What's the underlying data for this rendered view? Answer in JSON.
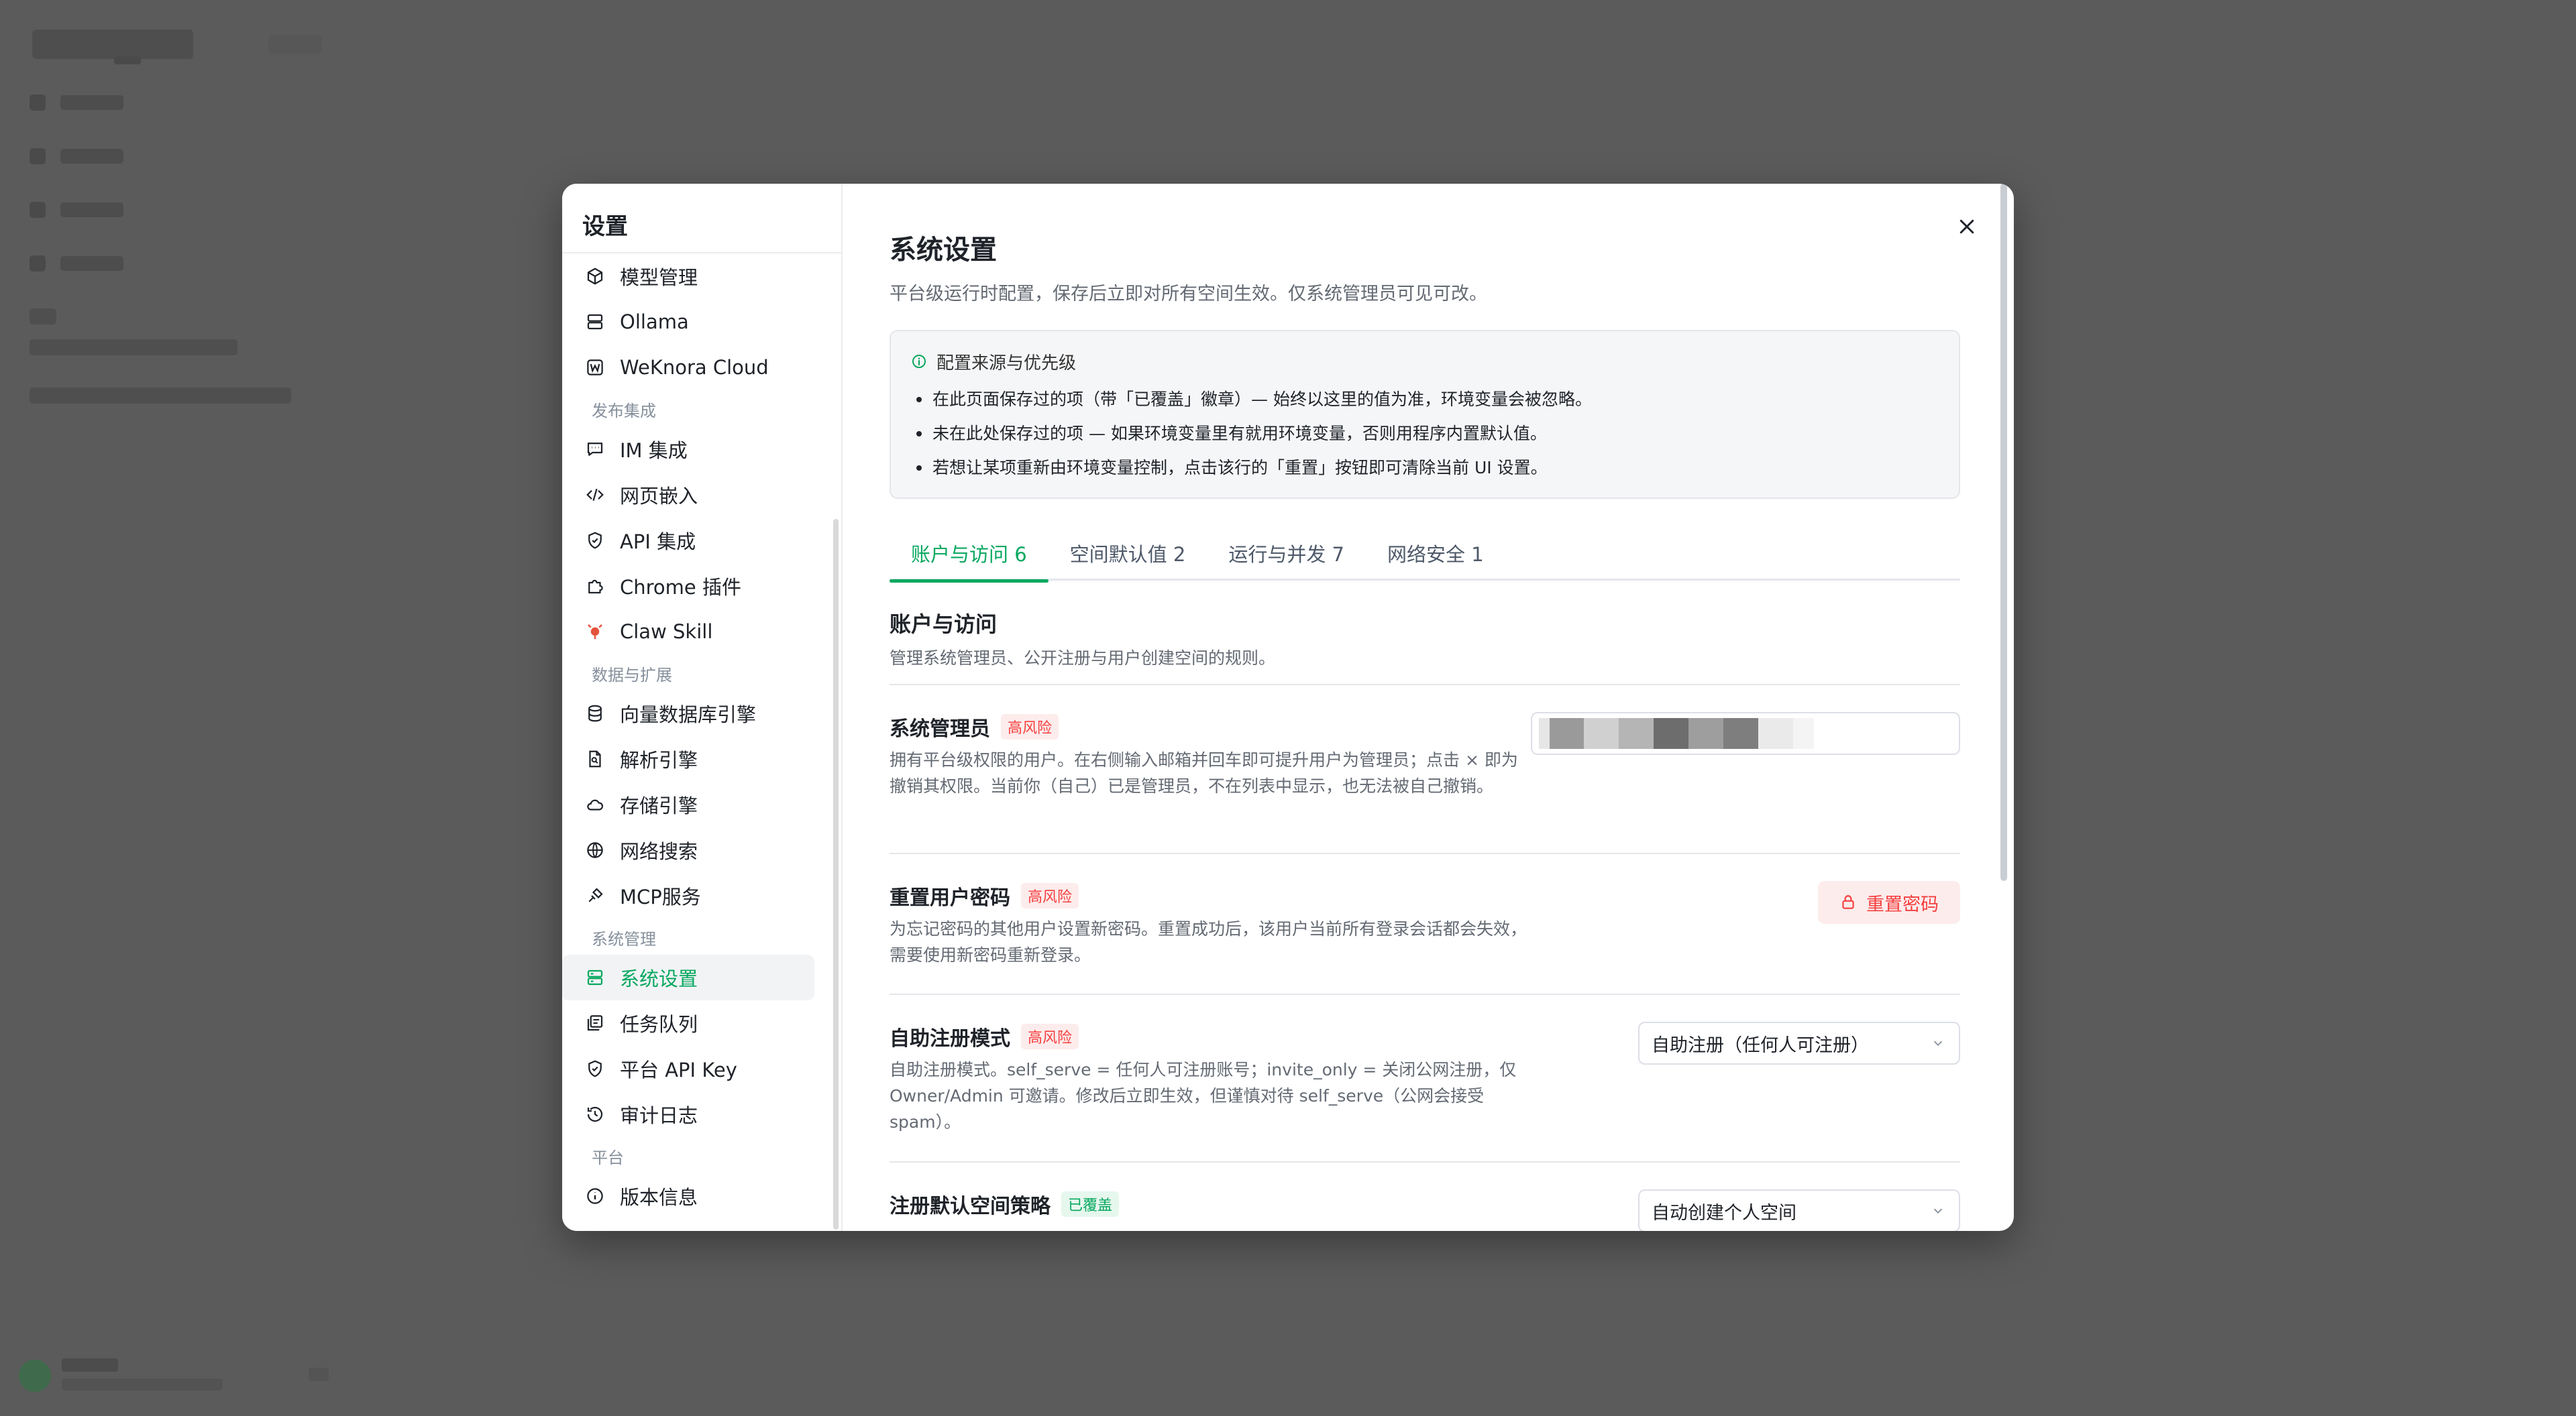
{
  "colors": {
    "accent": "#07a85f",
    "danger": "#f53f3f",
    "overlay": "#5b5b5b"
  },
  "modal": {
    "side_title": "设置",
    "groups": [
      {
        "label": "",
        "items": [
          {
            "label": "模型管理",
            "icon": "cube-icon"
          },
          {
            "label": "Ollama",
            "icon": "server-icon"
          },
          {
            "label": "WeKnora Cloud",
            "icon": "w-logo-icon"
          }
        ]
      },
      {
        "label": "发布集成",
        "items": [
          {
            "label": "IM 集成",
            "icon": "chat-icon"
          },
          {
            "label": "网页嵌入",
            "icon": "code-icon"
          },
          {
            "label": "API 集成",
            "icon": "shield-check-icon"
          },
          {
            "label": "Chrome 插件",
            "icon": "puzzle-icon"
          },
          {
            "label": "Claw Skill",
            "icon": "lobster-icon"
          }
        ]
      },
      {
        "label": "数据与扩展",
        "items": [
          {
            "label": "向量数据库引擎",
            "icon": "database-icon"
          },
          {
            "label": "解析引擎",
            "icon": "file-search-icon"
          },
          {
            "label": "存储引擎",
            "icon": "cloud-icon"
          },
          {
            "label": "网络搜索",
            "icon": "globe-icon"
          },
          {
            "label": "MCP服务",
            "icon": "plug-icon"
          }
        ]
      },
      {
        "label": "系统管理",
        "items": [
          {
            "label": "系统设置",
            "icon": "settings-stack-icon",
            "active": true
          },
          {
            "label": "任务队列",
            "icon": "queue-icon"
          },
          {
            "label": "平台 API Key",
            "icon": "shield-key-icon"
          },
          {
            "label": "审计日志",
            "icon": "history-icon"
          }
        ]
      },
      {
        "label": "平台",
        "items": [
          {
            "label": "版本信息",
            "icon": "info-icon"
          }
        ]
      }
    ],
    "title": "系统设置",
    "description": "平台级运行时配置，保存后立即对所有空间生效。仅系统管理员可见可改。",
    "notice": {
      "heading": "配置来源与优先级",
      "items": [
        "在此页面保存过的项（带「已覆盖」徽章）— 始终以这里的值为准，环境变量会被忽略。",
        "未在此处保存过的项 — 如果环境变量里有就用环境变量，否则用程序内置默认值。",
        "若想让某项重新由环境变量控制，点击该行的「重置」按钮即可清除当前 UI 设置。"
      ]
    },
    "tabs": [
      {
        "label": "账户与访问 6",
        "active": true
      },
      {
        "label": "空间默认值 2"
      },
      {
        "label": "运行与并发 7"
      },
      {
        "label": "网络安全 1"
      }
    ],
    "section": {
      "title": "账户与访问",
      "description": "管理系统管理员、公开注册与用户创建空间的规则。"
    },
    "rows": {
      "admins": {
        "label": "系统管理员",
        "badge": "高风险",
        "description": "拥有平台级权限的用户。在右侧输入邮箱并回车即可提升用户为管理员；点击 × 即为撤销其权限。当前你（自己）已是管理员，不在列表中显示，也无法被自己撤销。"
      },
      "reset_password": {
        "label": "重置用户密码",
        "badge": "高风险",
        "description": "为忘记密码的其他用户设置新密码。重置成功后，该用户当前所有登录会话都会失效，需要使用新密码重新登录。",
        "button": "重置密码"
      },
      "self_register": {
        "label": "自助注册模式",
        "badge": "高风险",
        "description": "自助注册模式。self_serve = 任何人可注册账号；invite_only = 关闭公网注册，仅 Owner/Admin 可邀请。修改后立即生效，但谨慎对待 self_serve（公网会接受 spam）。",
        "value": "自助注册（任何人可注册）"
      },
      "default_space": {
        "label": "注册默认空间策略",
        "badge": "已覆盖",
        "value": "自动创建个人空间"
      }
    }
  }
}
